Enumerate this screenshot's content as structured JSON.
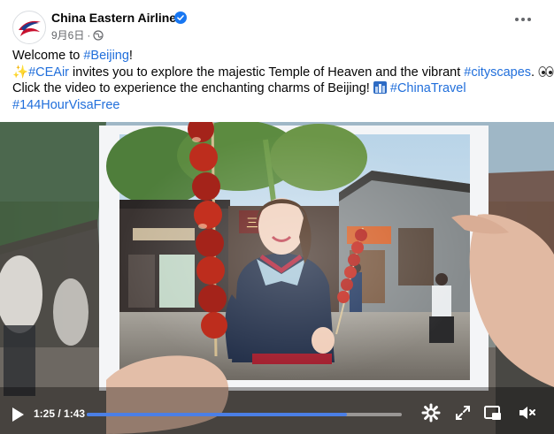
{
  "header": {
    "page_name": "China Eastern Airlines",
    "date": "9月6日",
    "dot": "·"
  },
  "caption": {
    "line1_prefix": "Welcome to ",
    "line1_tag": "#Beijing",
    "line1_suffix": "!",
    "line2_tag1": "#CEAir",
    "line2_text": " invites you to explore the majestic Temple of Heaven and the vibrant ",
    "line2_tag2": "#cityscapes",
    "line2_suffix": ".",
    "line3_text": "Click the video to experience the enchanting charms of Beijing!",
    "line3_tag": "#ChinaTravel",
    "line4_tag": "#144HourVisaFree"
  },
  "video": {
    "time": "1:25 / 1:43",
    "progress": 0.825
  },
  "colors": {
    "link": "#216fdb",
    "progress": "#4b7fe6",
    "verified": "#1877f2"
  },
  "icons": [
    "sparkles-icon",
    "eyes-icon",
    "city-icon",
    "globe-icon",
    "play-icon",
    "settings-icon",
    "fullscreen-icon",
    "pip-icon",
    "volume-icon"
  ]
}
